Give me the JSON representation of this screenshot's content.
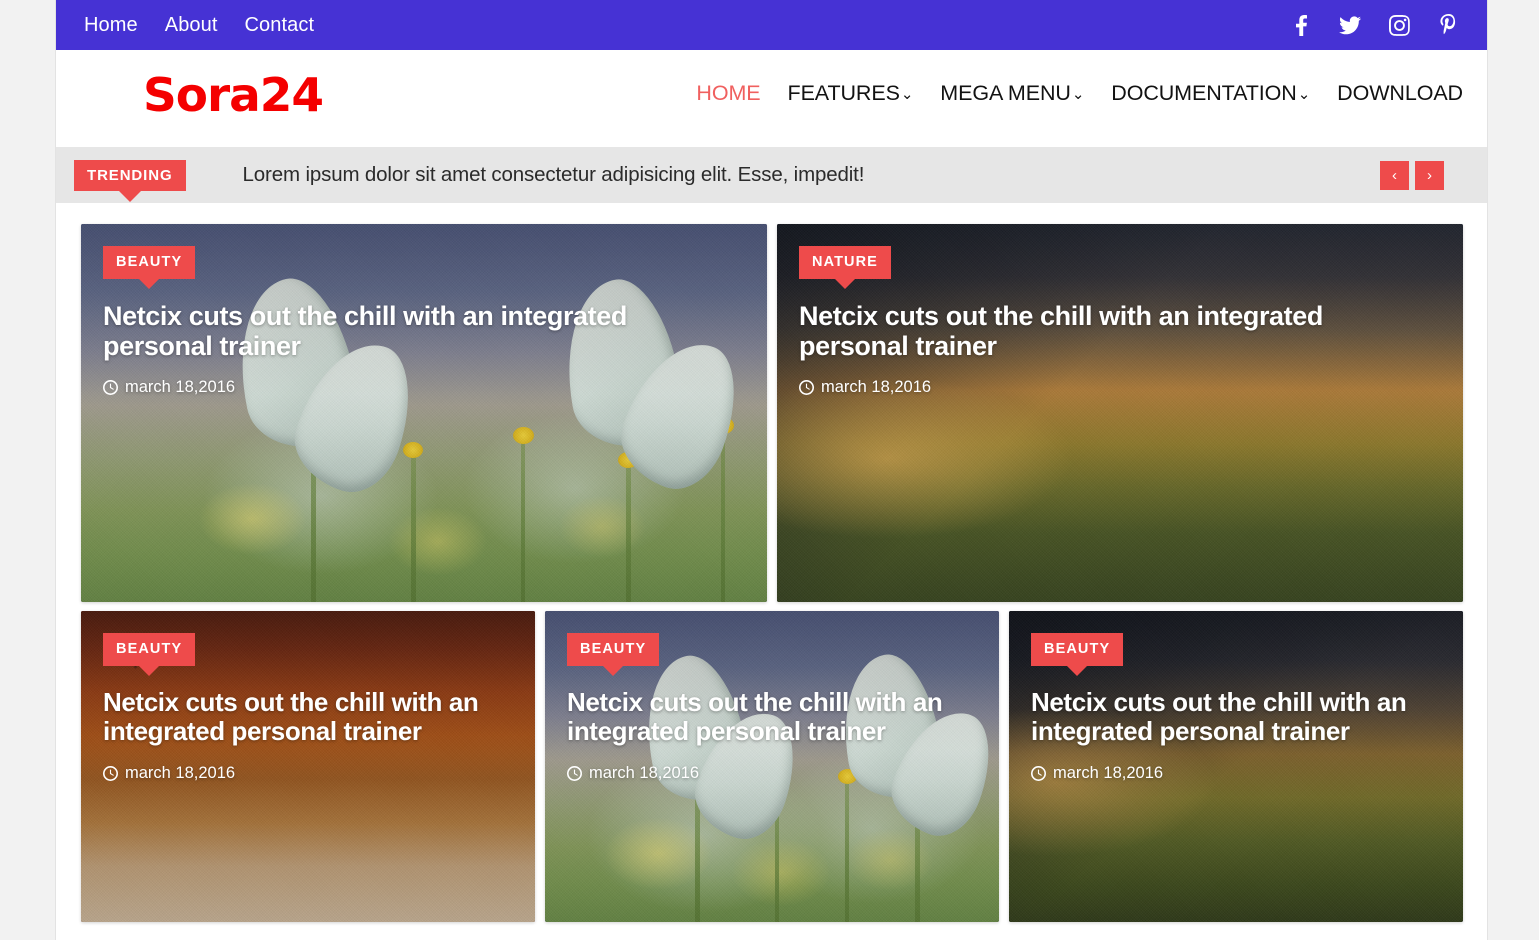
{
  "topbar": {
    "links": [
      {
        "label": "Home"
      },
      {
        "label": "About"
      },
      {
        "label": "Contact"
      }
    ],
    "social": [
      {
        "name": "facebook-icon"
      },
      {
        "name": "twitter-icon"
      },
      {
        "name": "instagram-icon"
      },
      {
        "name": "pinterest-icon"
      }
    ],
    "background_color": "#4632d4"
  },
  "header": {
    "logo": "Sora24",
    "logo_color": "#f40000",
    "nav": [
      {
        "label": "HOME",
        "active": true,
        "caret": ""
      },
      {
        "label": "FEATURES",
        "active": false,
        "caret": "⌄"
      },
      {
        "label": "MEGA MENU",
        "active": false,
        "caret": "⌄"
      },
      {
        "label": "DOCUMENTATION",
        "active": false,
        "caret": "⌄"
      },
      {
        "label": "DOWNLOAD",
        "active": false,
        "caret": ""
      }
    ],
    "active_color": "#f0605f"
  },
  "trending": {
    "badge": "TRENDING",
    "text": "Lorem ipsum dolor sit amet consectetur adipisicing elit. Esse, impedit!",
    "prev_icon": "‹",
    "next_icon": "›",
    "accent_color": "#ee4b4b",
    "background_color": "#e6e6e6"
  },
  "cards": {
    "top": [
      {
        "category": "BEAUTY",
        "title": "Netcix cuts out the chill with an integrated personal trainer",
        "date": "march 18,2016",
        "image": "butterflies-on-flowers"
      },
      {
        "category": "NATURE",
        "title": "Netcix cuts out the chill with an integrated personal trainer",
        "date": "march 18,2016",
        "image": "mountain-sunset-landscape"
      }
    ],
    "bottom": [
      {
        "category": "BEAUTY",
        "title": "Netcix cuts out the chill with an integrated personal trainer",
        "date": "march 18,2016",
        "image": "autumn-forest-path"
      },
      {
        "category": "BEAUTY",
        "title": "Netcix cuts out the chill with an integrated personal trainer",
        "date": "march 18,2016",
        "image": "butterflies-on-flowers"
      },
      {
        "category": "BEAUTY",
        "title": "Netcix cuts out the chill with an integrated personal trainer",
        "date": "march 18,2016",
        "image": "mountain-dark-landscape"
      }
    ]
  }
}
